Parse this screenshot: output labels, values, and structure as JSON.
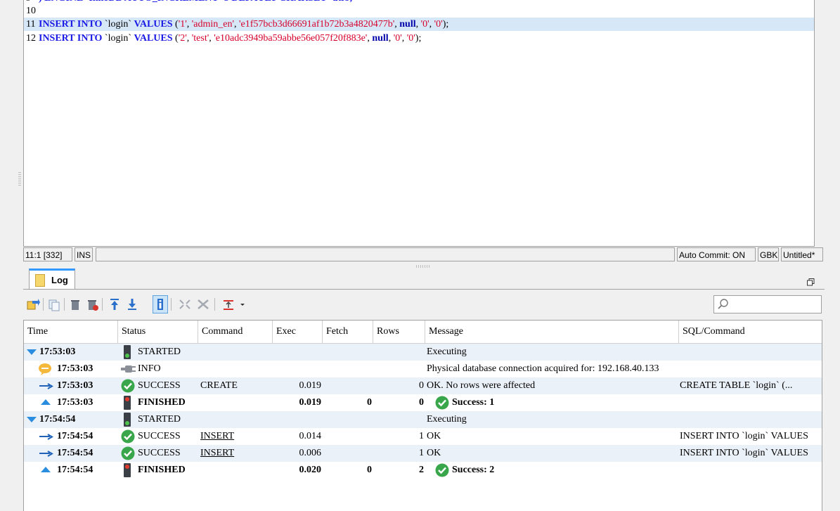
{
  "editor": {
    "lines": [
      {
        "num": "10",
        "text": ""
      },
      {
        "num": "11",
        "kw1": "INSERT INTO",
        "ident": " `login` ",
        "kw2": "VALUES",
        "p_open": " (",
        "v1": "'1'",
        "c1": ", ",
        "v2": "'admin_en'",
        "c2": ", ",
        "v3": "'e1f57bcb3d66691af1b72b3a4820477b'",
        "c3": ", ",
        "nul": "null",
        "c4": ", ",
        "v4": "'0'",
        "c5": ", ",
        "v5": "'0'",
        "p_close": ");"
      },
      {
        "num": "12",
        "kw1": "INSERT INTO",
        "ident": " `login` ",
        "kw2": "VALUES",
        "p_open": " (",
        "v1": "'2'",
        "c1": ", ",
        "v2": "'test'",
        "c2": ", ",
        "v3": "'e10adc3949ba59abbe56e057f20f883e'",
        "c3": ", ",
        "nul": "null",
        "c4": ", ",
        "v4": "'0'",
        "c5": ", ",
        "v5": "'0'",
        "p_close": ");"
      }
    ]
  },
  "status_bar": {
    "position": "11:1 [332]",
    "mode": "INS",
    "auto_commit": "Auto Commit: ON",
    "encoding": "GBK",
    "doc_name": "Untitled*"
  },
  "log_panel": {
    "tab_label": "Log",
    "columns": [
      "Time",
      "Status",
      "Command",
      "Exec",
      "Fetch",
      "Rows",
      "Message",
      "SQL/Command"
    ],
    "rows": [
      {
        "time": "17:53:03",
        "status": "STARTED",
        "command": "",
        "exec": "",
        "fetch": "",
        "rows": "",
        "message": "Executing",
        "sql": ""
      },
      {
        "time": "17:53:03",
        "status": "INFO",
        "command": "",
        "exec": "",
        "fetch": "",
        "rows": "",
        "message": "Physical database connection acquired for: 192.168.40.133",
        "sql": ""
      },
      {
        "time": "17:53:03",
        "status": "SUCCESS",
        "command": "CREATE",
        "exec": "0.019",
        "fetch": "",
        "rows": "0",
        "message": "OK. No rows were affected",
        "sql": "CREATE TABLE `login` (..."
      },
      {
        "time": "17:53:03",
        "status": "FINISHED",
        "command": "",
        "exec": "0.019",
        "fetch": "0",
        "rows": "0",
        "message": "Success: 1",
        "sql": ""
      },
      {
        "time": "17:54:54",
        "status": "STARTED",
        "command": "",
        "exec": "",
        "fetch": "",
        "rows": "",
        "message": "Executing",
        "sql": ""
      },
      {
        "time": "17:54:54",
        "status": "SUCCESS",
        "command": "INSERT",
        "exec": "0.014",
        "fetch": "",
        "rows": "1",
        "message": "OK",
        "sql": "INSERT INTO `login` VALUES"
      },
      {
        "time": "17:54:54",
        "status": "SUCCESS",
        "command": "INSERT",
        "exec": "0.006",
        "fetch": "",
        "rows": "1",
        "message": "OK",
        "sql": "INSERT INTO `login` VALUES"
      },
      {
        "time": "17:54:54",
        "status": "FINISHED",
        "command": "",
        "exec": "0.020",
        "fetch": "0",
        "rows": "2",
        "message": "Success: 2",
        "sql": ""
      }
    ]
  },
  "icons": {
    "expand": "triangle-down-icon",
    "info": "speech-bubble-icon",
    "child": "arrow-right-icon",
    "finished": "triangle-up-icon",
    "started_status": "green-traffic-light-icon",
    "finished_status": "red-traffic-light-icon",
    "success": "check-circle-icon",
    "info_status": "plug-icon"
  },
  "colors": {
    "keyword": "#1a1ae6",
    "string": "#d6002a",
    "current_line": "#d6e7f8",
    "success": "#3aa64b",
    "accent": "#3399ff",
    "row_alt": "#ebf1f8"
  },
  "search": {
    "placeholder": ""
  }
}
